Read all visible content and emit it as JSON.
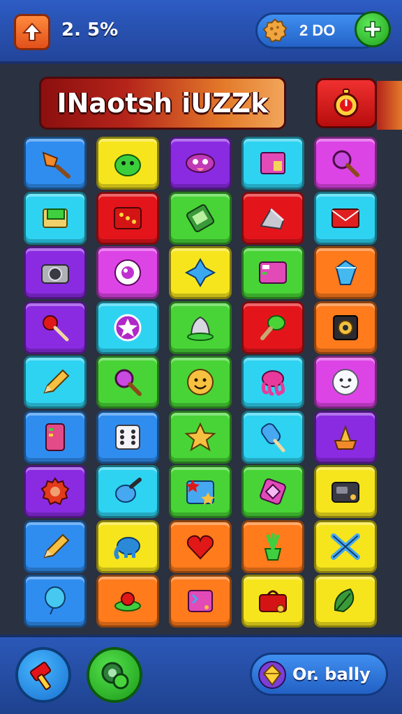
{
  "header": {
    "progress_text": "2. 5%",
    "coins_text": "2 DO"
  },
  "title": {
    "text": "INaotsh iUZZk"
  },
  "footer": {
    "daily_label": "Or. bally"
  },
  "colors": {
    "blue": "#2f8df0",
    "yellow": "#f6e51c",
    "purple": "#8a2be2",
    "cyan": "#2ed3f2",
    "magenta": "#dd44e6",
    "red": "#e3151b",
    "green": "#48d436",
    "orange": "#ff7b1c"
  },
  "grid": {
    "rows": [
      [
        {
          "color": "blue",
          "icon": "broom-icon"
        },
        {
          "color": "yellow",
          "icon": "green-monster-icon"
        },
        {
          "color": "purple",
          "icon": "purple-creature-icon"
        },
        {
          "color": "cyan",
          "icon": "pink-box-icon"
        },
        {
          "color": "magenta",
          "icon": "magnifier-icon"
        }
      ],
      [
        {
          "color": "cyan",
          "icon": "scroll-icon"
        },
        {
          "color": "red",
          "icon": "red-dice-icon"
        },
        {
          "color": "green",
          "icon": "green-phone-icon"
        },
        {
          "color": "red",
          "icon": "gray-rock-icon"
        },
        {
          "color": "cyan",
          "icon": "envelope-icon"
        }
      ],
      [
        {
          "color": "purple",
          "icon": "camera-icon"
        },
        {
          "color": "magenta",
          "icon": "eye-orb-icon"
        },
        {
          "color": "yellow",
          "icon": "blue-star-shape-icon"
        },
        {
          "color": "green",
          "icon": "pink-panel-icon"
        },
        {
          "color": "orange",
          "icon": "blue-gem-icon"
        }
      ],
      [
        {
          "color": "purple",
          "icon": "red-lollipop-icon"
        },
        {
          "color": "cyan",
          "icon": "star-coin-icon"
        },
        {
          "color": "green",
          "icon": "bell-icon"
        },
        {
          "color": "red",
          "icon": "green-brush-icon"
        },
        {
          "color": "orange",
          "icon": "speaker-icon"
        }
      ],
      [
        {
          "color": "cyan",
          "icon": "pencil-icon"
        },
        {
          "color": "green",
          "icon": "magnifier-icon"
        },
        {
          "color": "green",
          "icon": "smiley-icon"
        },
        {
          "color": "cyan",
          "icon": "pink-octopus-icon"
        },
        {
          "color": "magenta",
          "icon": "white-face-icon"
        }
      ],
      [
        {
          "color": "blue",
          "icon": "pink-phone-icon"
        },
        {
          "color": "blue",
          "icon": "dice-icon"
        },
        {
          "color": "green",
          "icon": "star-icon"
        },
        {
          "color": "cyan",
          "icon": "popsicle-icon"
        },
        {
          "color": "purple",
          "icon": "cake-icon"
        }
      ],
      [
        {
          "color": "purple",
          "icon": "red-gear-icon"
        },
        {
          "color": "cyan",
          "icon": "blue-spray-icon"
        },
        {
          "color": "green",
          "icon": "stars-card-icon"
        },
        {
          "color": "green",
          "icon": "pink-gem-icon"
        },
        {
          "color": "yellow",
          "icon": "dark-camera-icon"
        }
      ],
      [
        {
          "color": "blue",
          "icon": "pencil-icon"
        },
        {
          "color": "yellow",
          "icon": "blue-elephant-icon"
        },
        {
          "color": "orange",
          "icon": "heart-icon"
        },
        {
          "color": "orange",
          "icon": "potted-plant-icon"
        },
        {
          "color": "yellow",
          "icon": "crossed-tools-icon"
        }
      ],
      [
        {
          "color": "blue",
          "icon": "balloon-icon"
        },
        {
          "color": "orange",
          "icon": "ufo-icon"
        },
        {
          "color": "orange",
          "icon": "pink-card-icon"
        },
        {
          "color": "yellow",
          "icon": "red-bag-icon"
        },
        {
          "color": "yellow",
          "icon": "green-leaf-icon"
        }
      ]
    ]
  }
}
